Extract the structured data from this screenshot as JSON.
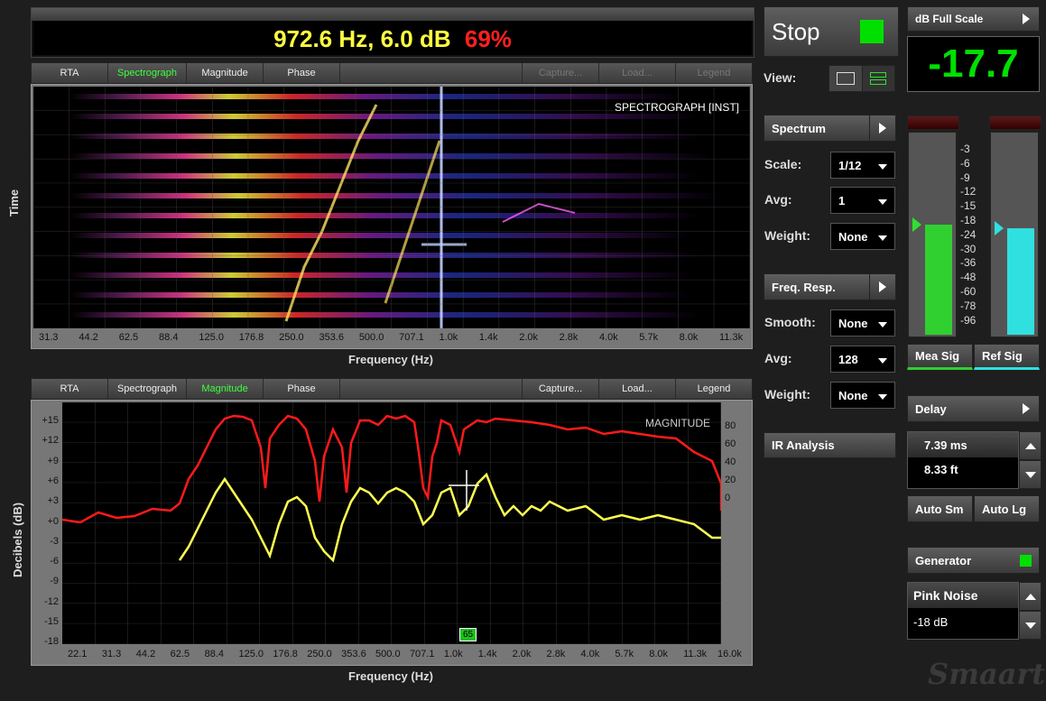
{
  "readout": {
    "frequency": "972.6 Hz, 6.0 dB",
    "percent": "69%"
  },
  "tabs_top": [
    "RTA",
    "Spectrograph",
    "Magnitude",
    "Phase"
  ],
  "tabs_top_right": [
    "Capture...",
    "Load...",
    "Legend"
  ],
  "tabs_bottom": [
    "RTA",
    "Spectrograph",
    "Magnitude",
    "Phase"
  ],
  "tabs_bottom_right": [
    "Capture...",
    "Load...",
    "Legend"
  ],
  "spectrograph": {
    "title": "SPECTROGRAPH [INST]",
    "ylabel": "Time",
    "xlabel": "Frequency (Hz)",
    "xticks": [
      "31.3",
      "44.2",
      "62.5",
      "88.4",
      "125.0",
      "176.8",
      "250.0",
      "353.6",
      "500.0",
      "707.1",
      "1.0k",
      "1.4k",
      "2.0k",
      "2.8k",
      "4.0k",
      "5.7k",
      "8.0k",
      "11.3k"
    ]
  },
  "magnitude": {
    "title": "MAGNITUDE",
    "ylabel": "Decibels (dB)",
    "xlabel": "Frequency (Hz)",
    "yticks_left": [
      "+15",
      "+12",
      "+9",
      "+6",
      "+3",
      "+0",
      "-3",
      "-6",
      "-9",
      "-12",
      "-15",
      "-18"
    ],
    "yticks_right": [
      "80",
      "60",
      "40",
      "20",
      "0"
    ],
    "xticks": [
      "22.1",
      "31.3",
      "44.2",
      "62.5",
      "88.4",
      "125.0",
      "176.8",
      "250.0",
      "353.6",
      "500.0",
      "707.1",
      "1.0k",
      "1.4k",
      "2.0k",
      "2.8k",
      "4.0k",
      "5.7k",
      "8.0k",
      "11.3k",
      "16.0k"
    ],
    "marker_label": "65"
  },
  "controls": {
    "stop_label": "Stop",
    "view_label": "View:",
    "spectrum_label": "Spectrum",
    "scale_label": "Scale:",
    "scale_value": "1/12",
    "avg_label": "Avg:",
    "avg_value": "1",
    "weight_label": "Weight:",
    "weight_value": "None",
    "freq_resp_label": "Freq. Resp.",
    "smooth_label": "Smooth:",
    "smooth_value": "None",
    "avg2_label": "Avg:",
    "avg2_value": "128",
    "weight2_label": "Weight:",
    "weight2_value": "None",
    "ir_label": "IR Analysis"
  },
  "meters": {
    "fullscale_label": "dB Full Scale",
    "value": "-17.7",
    "scale": [
      "-3",
      "-6",
      "-9",
      "-12",
      "-15",
      "-18",
      "-24",
      "-30",
      "-36",
      "-48",
      "-60",
      "-78",
      "-96"
    ],
    "mea_sig": "Mea Sig",
    "ref_sig": "Ref Sig",
    "mea_level": 0.55,
    "ref_level": 0.53
  },
  "delay": {
    "label": "Delay",
    "ms": "7.39 ms",
    "ft": "8.33 ft",
    "auto_sm": "Auto Sm",
    "auto_lg": "Auto Lg"
  },
  "generator": {
    "label": "Generator",
    "signal": "Pink Noise",
    "level": "-18 dB"
  },
  "logo": "Smaart",
  "colors": {
    "accent_green": "#00e000",
    "readout_yellow": "#ffff40",
    "readout_red": "#ff2020",
    "trace_red": "#ff1a1a",
    "trace_yellow": "#ffff50",
    "meter_green": "#30d030",
    "meter_cyan": "#30e0e0"
  }
}
